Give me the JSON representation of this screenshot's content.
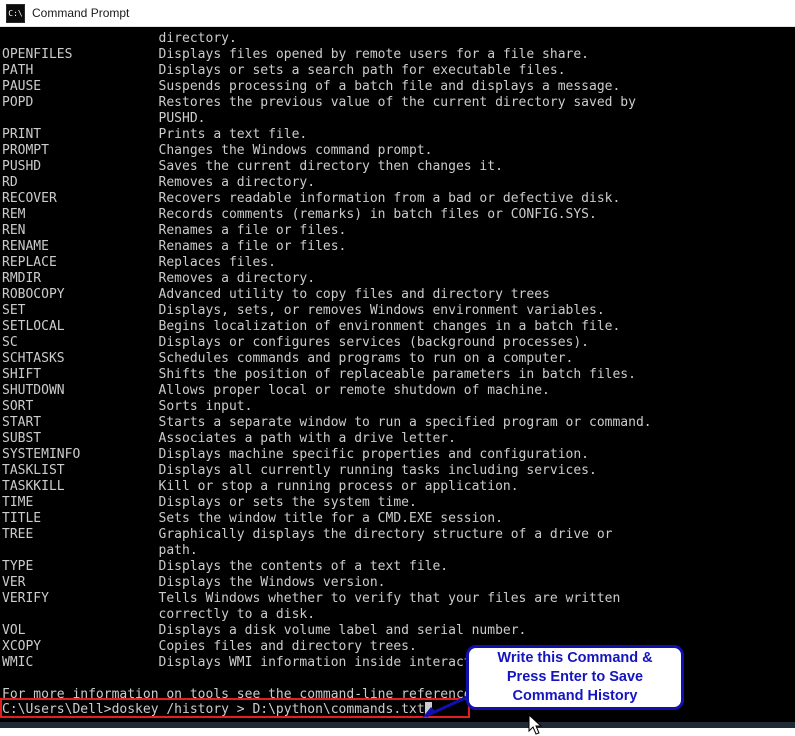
{
  "window": {
    "title": "Command Prompt",
    "icon": "command-prompt-icon",
    "icon_glyph": "C:\\"
  },
  "console": {
    "lines": [
      "                    directory.",
      "OPENFILES           Displays files opened by remote users for a file share.",
      "PATH                Displays or sets a search path for executable files.",
      "PAUSE               Suspends processing of a batch file and displays a message.",
      "POPD                Restores the previous value of the current directory saved by",
      "                    PUSHD.",
      "PRINT               Prints a text file.",
      "PROMPT              Changes the Windows command prompt.",
      "PUSHD               Saves the current directory then changes it.",
      "RD                  Removes a directory.",
      "RECOVER             Recovers readable information from a bad or defective disk.",
      "REM                 Records comments (remarks) in batch files or CONFIG.SYS.",
      "REN                 Renames a file or files.",
      "RENAME              Renames a file or files.",
      "REPLACE             Replaces files.",
      "RMDIR               Removes a directory.",
      "ROBOCOPY            Advanced utility to copy files and directory trees",
      "SET                 Displays, sets, or removes Windows environment variables.",
      "SETLOCAL            Begins localization of environment changes in a batch file.",
      "SC                  Displays or configures services (background processes).",
      "SCHTASKS            Schedules commands and programs to run on a computer.",
      "SHIFT               Shifts the position of replaceable parameters in batch files.",
      "SHUTDOWN            Allows proper local or remote shutdown of machine.",
      "SORT                Sorts input.",
      "START               Starts a separate window to run a specified program or command.",
      "SUBST               Associates a path with a drive letter.",
      "SYSTEMINFO          Displays machine specific properties and configuration.",
      "TASKLIST            Displays all currently running tasks including services.",
      "TASKKILL            Kill or stop a running process or application.",
      "TIME                Displays or sets the system time.",
      "TITLE               Sets the window title for a CMD.EXE session.",
      "TREE                Graphically displays the directory structure of a drive or",
      "                    path.",
      "TYPE                Displays the contents of a text file.",
      "VER                 Displays the Windows version.",
      "VERIFY              Tells Windows whether to verify that your files are written",
      "                    correctly to a disk.",
      "VOL                 Displays a disk volume label and serial number.",
      "XCOPY               Copies files and directory trees.",
      "WMIC                Displays WMI information inside interactive command shell.",
      "",
      "For more information on tools see the command-line reference in the online help."
    ]
  },
  "prompt": {
    "text": "C:\\Users\\Dell>doskey /history > D:\\python\\commands.txt",
    "cursor": "block-caret"
  },
  "annotation": {
    "callout_line_1": "Write this Command &",
    "callout_line_2": "Press Enter to Save",
    "callout_line_3": "Command History",
    "border_color": "#1010b0",
    "text_color": "#1515c0",
    "highlight_color": "#e02020"
  }
}
